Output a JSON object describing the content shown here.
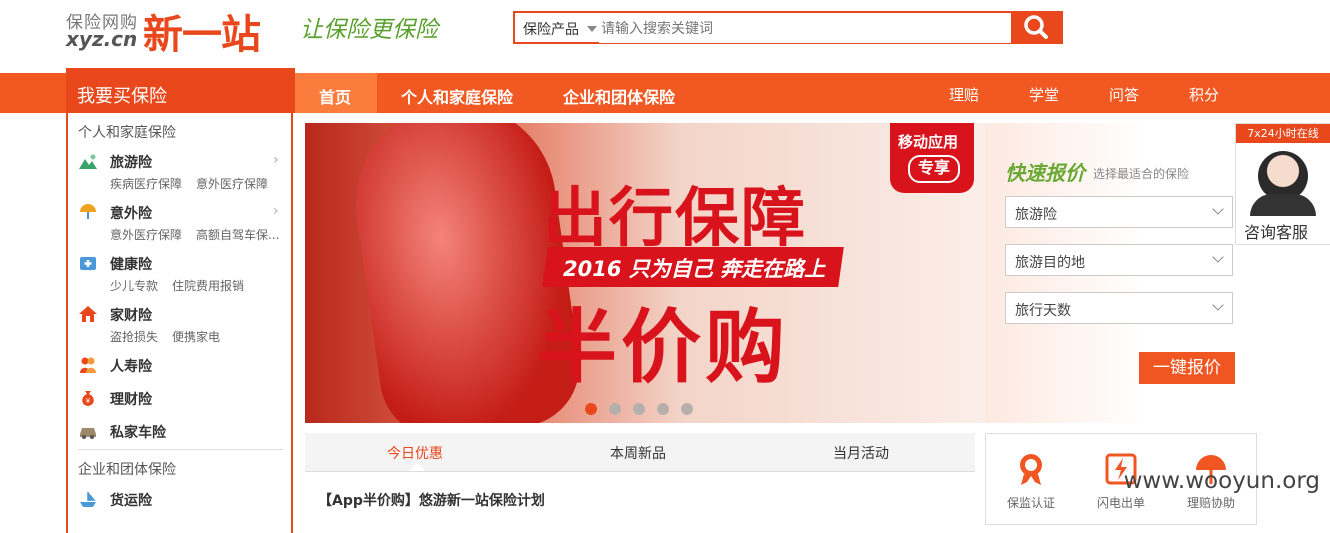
{
  "logo": {
    "sub": "保险网购",
    "domain": "xyz.cn",
    "main": "新一站",
    "slogan": "让保险更保险"
  },
  "search": {
    "category": "保险产品",
    "placeholder": "请输入搜索关键词"
  },
  "nav": {
    "buy_title": "我要买保险",
    "items": [
      "首页",
      "个人和家庭保险",
      "企业和团体保险"
    ],
    "right_items": [
      "理赔",
      "学堂",
      "问答",
      "积分"
    ]
  },
  "sidebar": {
    "personal_title": "个人和家庭保险",
    "personal": [
      {
        "title": "旅游险",
        "subs": [
          "疾病医疗保障",
          "意外医疗保障"
        ],
        "icon": "mountain-icon"
      },
      {
        "title": "意外险",
        "subs": [
          "意外医疗保障",
          "高额自驾车保..."
        ],
        "icon": "umbrella-icon"
      },
      {
        "title": "健康险",
        "subs": [
          "少儿专款",
          "住院费用报销"
        ],
        "icon": "medical-kit-icon"
      },
      {
        "title": "家财险",
        "subs": [
          "盗抢损失",
          "便携家电"
        ],
        "icon": "house-icon"
      },
      {
        "title": "人寿险",
        "subs": [],
        "icon": "people-icon"
      },
      {
        "title": "理财险",
        "subs": [],
        "icon": "money-bag-icon"
      },
      {
        "title": "私家车险",
        "subs": [],
        "icon": "car-icon"
      }
    ],
    "enterprise_title": "企业和团体保险",
    "enterprise": [
      {
        "title": "货运险",
        "icon": "ship-icon"
      }
    ]
  },
  "banner": {
    "title": "出行保障",
    "strip": "2016 只为自己 奔走在路上",
    "big": "半价购",
    "tag_line1": "移动应用",
    "tag_line2": "专享",
    "slide_count": 5,
    "active_slide": 1
  },
  "quote": {
    "title": "快速报价",
    "subtitle": "选择最适合的保险",
    "selects": [
      "旅游险",
      "旅游目的地",
      "旅行天数"
    ],
    "button": "一键报价"
  },
  "service": {
    "top": "7x24小时在线",
    "label": "咨询客服"
  },
  "tabs": [
    "今日优惠",
    "本周新品",
    "当月活动"
  ],
  "promo": "【App半价购】悠游新一站保险计划",
  "features": [
    "保监认证",
    "闪电出单",
    "理赔协助"
  ],
  "watermark": "www.wooyun.org",
  "colors": {
    "accent": "#e8481c",
    "nav": "#f25822",
    "green": "#6aa936"
  }
}
